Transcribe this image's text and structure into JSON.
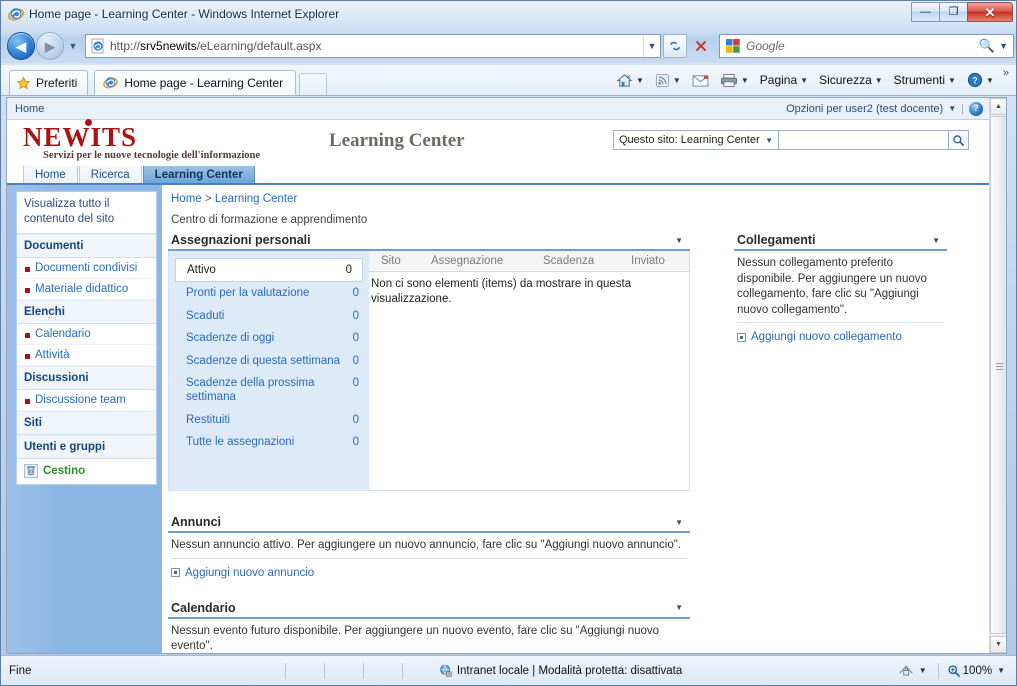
{
  "browser": {
    "window_title": "Home page - Learning Center - Windows Internet Explorer",
    "minimize_glyph": "—",
    "maximize_glyph": "❐",
    "close_glyph": "✕",
    "back_glyph": "◀",
    "forward_glyph": "▶",
    "history_caret": "▼",
    "address": {
      "scheme": "http://",
      "host": "srv5newits",
      "path": "/eLearning/default.aspx",
      "full": "http://srv5newits/eLearning/default.aspx",
      "dropdown_caret": "▼"
    },
    "refresh_label": "↻",
    "stop_label": "✕",
    "search": {
      "placeholder": "Google",
      "magnifier": "🔍",
      "caret": "▼"
    },
    "favorites_label": "Preferiti",
    "tabs": [
      {
        "label": "Home page - Learning Center",
        "active": true
      }
    ],
    "new_tab_label": "",
    "command_bar": [
      {
        "name": "home",
        "label": "",
        "icon": "home-icon",
        "has_caret": true
      },
      {
        "name": "feeds",
        "label": "",
        "icon": "rss-icon",
        "has_caret": true
      },
      {
        "name": "mail",
        "label": "",
        "icon": "mail-icon",
        "has_caret": false
      },
      {
        "name": "print",
        "label": "",
        "icon": "printer-icon",
        "has_caret": true
      },
      {
        "name": "page",
        "label": "Pagina",
        "icon": "",
        "has_caret": true
      },
      {
        "name": "security",
        "label": "Sicurezza",
        "icon": "",
        "has_caret": true
      },
      {
        "name": "tools",
        "label": "Strumenti",
        "icon": "",
        "has_caret": true
      },
      {
        "name": "help",
        "label": "",
        "icon": "help-icon",
        "has_caret": true
      }
    ],
    "overflow_label": "»"
  },
  "status_bar": {
    "left_text": "Fine",
    "zone_text": "Intranet locale | Modalità protetta: disattivata",
    "zone_icon": "globe-icon",
    "privacy_icon": "privacy-icon",
    "zoom_level": "100%",
    "caret": "▼"
  },
  "sharepoint": {
    "top_band": {
      "home_link": "Home",
      "user_options": "Opzioni per user2 (test docente)",
      "caret": "▼",
      "separator": "|",
      "help_glyph": "?"
    },
    "branding": {
      "logo_text": "NEWITS",
      "logo_tagline": "Servizi per le nuove tecnologie dell'informazione",
      "site_title": "Learning Center",
      "logo_color": "#a81414"
    },
    "search": {
      "scope_label": "Questo sito: Learning Center",
      "scope_caret": "▼",
      "input_value": "",
      "go_glyph": "🔍"
    },
    "site_tabs": [
      {
        "label": "Home",
        "active": false
      },
      {
        "label": "Ricerca",
        "active": false
      },
      {
        "label": "Learning Center",
        "active": true
      }
    ],
    "quick_launch": {
      "view_all": "Visualizza tutto il contenuto del sito",
      "groups": [
        {
          "header": "Documenti",
          "links": [
            "Documenti condivisi",
            "Materiale didattico"
          ]
        },
        {
          "header": "Elenchi",
          "links": [
            "Calendario",
            "Attività"
          ]
        },
        {
          "header": "Discussioni",
          "links": [
            "Discussione team"
          ]
        },
        {
          "header": "Siti",
          "links": []
        },
        {
          "header": "Utenti e gruppi",
          "links": []
        }
      ],
      "recycle_bin": "Cestino"
    },
    "breadcrumb": {
      "home": "Home",
      "separator": ">",
      "current": "Learning Center"
    },
    "page_description": "Centro di formazione e apprendimento",
    "webparts": {
      "assignments": {
        "title": "Assegnazioni personali",
        "menu_caret": "▼",
        "filters": [
          {
            "label": "Attivo",
            "count": "0",
            "selected": true
          },
          {
            "label": "Pronti per la valutazione",
            "count": "0",
            "selected": false
          },
          {
            "label": "Scaduti",
            "count": "0",
            "selected": false
          },
          {
            "label": "Scadenze di oggi",
            "count": "0",
            "selected": false
          },
          {
            "label": "Scadenze di questa settimana",
            "count": "0",
            "selected": false
          },
          {
            "label": "Scadenze della prossima settimana",
            "count": "0",
            "selected": false
          },
          {
            "label": "Restituiti",
            "count": "0",
            "selected": false
          },
          {
            "label": "Tutte le assegnazioni",
            "count": "0",
            "selected": false
          }
        ],
        "columns": [
          "Sito",
          "Assegnazione",
          "Scadenza",
          "Inviato"
        ],
        "empty_message": "Non ci sono elementi (items) da mostrare in questa visualizzazione."
      },
      "announcements": {
        "title": "Annunci",
        "menu_caret": "▼",
        "empty_message": "Nessun annuncio attivo. Per aggiungere un nuovo annuncio, fare clic su \"Aggiungi nuovo annuncio\".",
        "add_link": "Aggiungi nuovo annuncio"
      },
      "calendar": {
        "title": "Calendario",
        "menu_caret": "▼",
        "empty_message": "Nessun evento futuro disponibile. Per aggiungere un nuovo evento, fare clic su \"Aggiungi nuovo evento\"."
      },
      "links": {
        "title": "Collegamenti",
        "menu_caret": "▼",
        "empty_message": "Nessun collegamento preferito disponibile. Per aggiungere un nuovo collegamento, fare clic su \"Aggiungi nuovo collegamento\".",
        "add_link": "Aggiungi nuovo collegamento"
      }
    }
  }
}
